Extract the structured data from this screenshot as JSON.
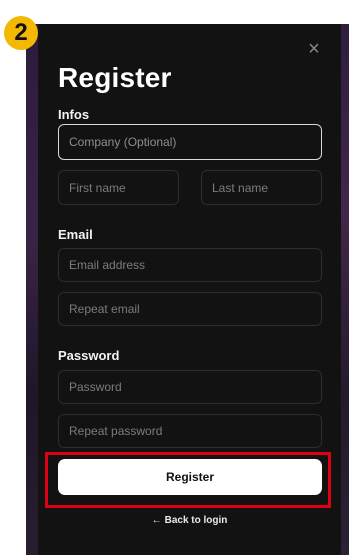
{
  "step": {
    "number": "2"
  },
  "modal": {
    "title": "Register",
    "close_icon": "×",
    "sections": {
      "infos": "Infos",
      "email": "Email",
      "password": "Password"
    },
    "fields": {
      "company_placeholder": "Company (Optional)",
      "first_name_placeholder": "First name",
      "last_name_placeholder": "Last name",
      "email_placeholder": "Email address",
      "repeat_email_placeholder": "Repeat email",
      "password_placeholder": "Password",
      "repeat_password_placeholder": "Repeat password"
    },
    "register_label": "Register",
    "back_arrow": "←",
    "back_label": "Back to login"
  },
  "colors": {
    "badge": "#f5b800",
    "modal_bg": "#121212",
    "highlight": "#e00016",
    "button_bg": "#ffffff"
  },
  "icons": [
    "close-icon",
    "back-arrow-icon"
  ]
}
